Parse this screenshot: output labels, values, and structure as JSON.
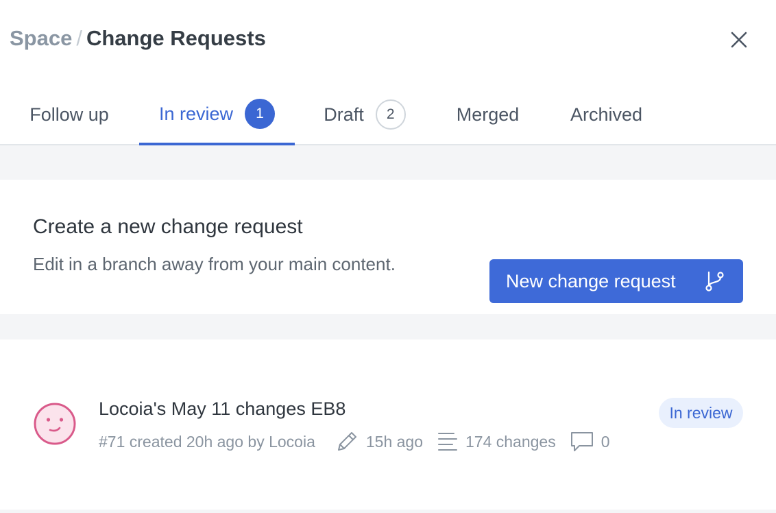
{
  "header": {
    "breadcrumb_space": "Space",
    "breadcrumb_separator": "/",
    "title": "Change Requests",
    "close_icon": "close-icon"
  },
  "tabs": [
    {
      "label": "Follow up",
      "count": null,
      "active": false
    },
    {
      "label": "In review",
      "count": "1",
      "active": true
    },
    {
      "label": "Draft",
      "count": "2",
      "active": false
    },
    {
      "label": "Merged",
      "count": null,
      "active": false
    },
    {
      "label": "Archived",
      "count": null,
      "active": false
    }
  ],
  "create_card": {
    "title": "Create a new change request",
    "subtitle": "Edit in a branch away from your main content.",
    "button_label": "New change request",
    "button_icon": "branch-icon"
  },
  "change_requests": [
    {
      "avatar_icon": "smiley-face-avatar",
      "title": "Locoia's May 11 changes EB8",
      "meta_created": "#71 created 20h ago by Locoia",
      "meta_edited": "15h ago",
      "meta_changes": "174 changes",
      "meta_comments": "0",
      "status": "In review"
    }
  ],
  "colors": {
    "accent": "#3b67d3",
    "button": "#3e6ad8",
    "badge_bg": "#e9f0fd",
    "avatar": "#d95a8a",
    "avatar_bg": "#fbe3ec",
    "content_bg": "#f4f5f7"
  }
}
